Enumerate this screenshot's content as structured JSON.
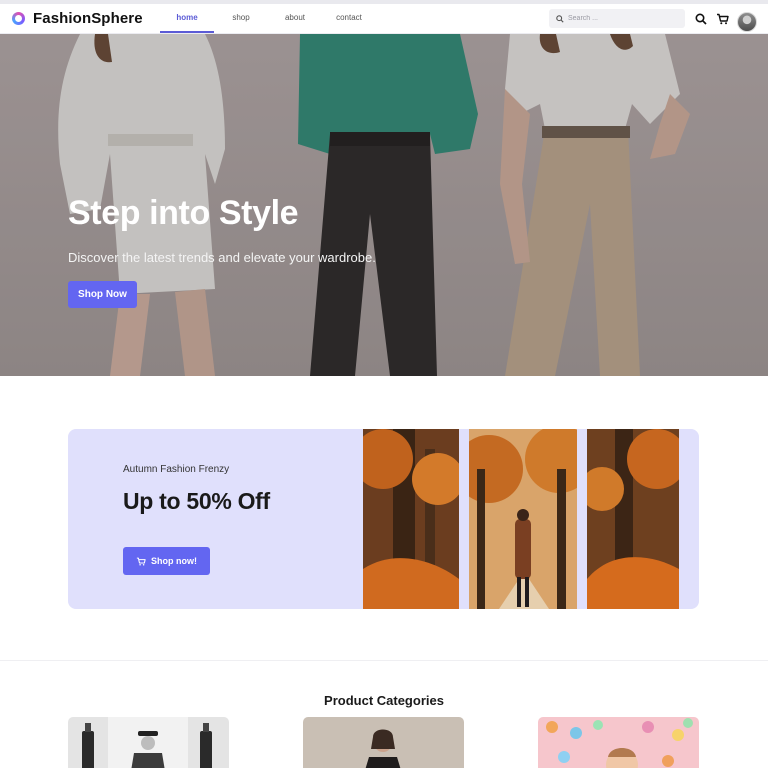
{
  "app": {
    "brand": "FashionSphere"
  },
  "nav": {
    "links": [
      {
        "label": "home",
        "active": true
      },
      {
        "label": "shop",
        "active": false
      },
      {
        "label": "about",
        "active": false
      },
      {
        "label": "contact",
        "active": false
      }
    ],
    "search_placeholder": "Search ..."
  },
  "hero": {
    "title": "Step into Style",
    "subtitle": "Discover the latest trends and elevate your wardrobe.",
    "cta_label": "Shop Now"
  },
  "promo": {
    "kicker": "Autumn Fashion Frenzy",
    "title": "Up to 50% Off",
    "cta_label": "Shop now!"
  },
  "categories": {
    "heading": "Product Categories"
  },
  "icons": {
    "logo": "ring-logo-icon",
    "search": "search-icon",
    "cart": "cart-icon",
    "avatar": "user-avatar"
  },
  "colors": {
    "accent": "#6366f1",
    "promo_bg": "#e0e0fc",
    "nav_active": "#5b5bd6"
  }
}
